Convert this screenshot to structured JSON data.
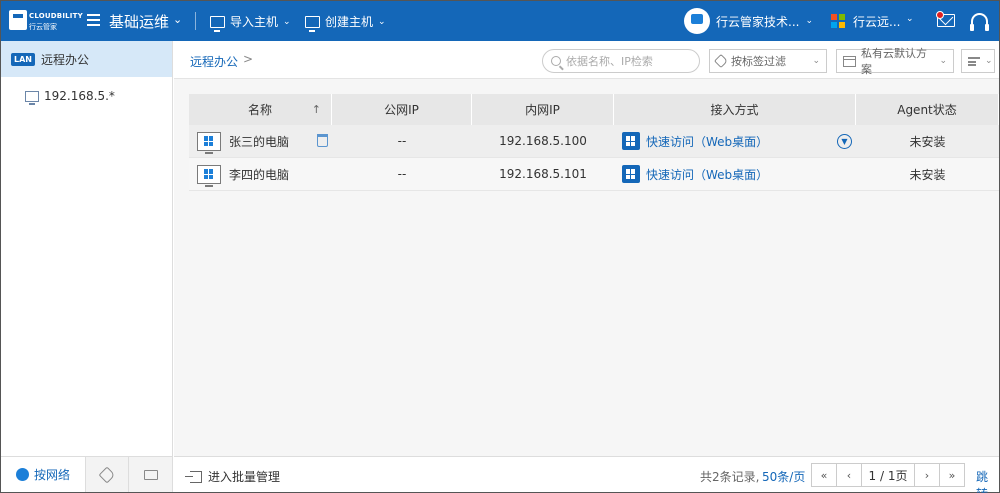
{
  "brand": {
    "name_en": "CLOUDBILITY",
    "name_cn": "行云管家"
  },
  "header": {
    "module_title": "基础运维",
    "import_host": "导入主机",
    "create_host": "创建主机",
    "tenant_name": "行云管家技术...",
    "org_name": "行云远...",
    "accent_color": "#1467b8"
  },
  "sidebar": {
    "root_badge": "LAN",
    "root_label": "远程办公",
    "items": [
      {
        "label": "192.168.5.*"
      }
    ],
    "tabs": [
      {
        "label": "按网络",
        "icon": "globe-icon"
      },
      {
        "label": "",
        "icon": "tag-icon"
      },
      {
        "label": "",
        "icon": "folder-icon"
      }
    ]
  },
  "toolbar": {
    "breadcrumb": "远程办公",
    "breadcrumb_sep": ">",
    "search_placeholder": "依据名称、IP检索",
    "tag_filter": "按标签过滤",
    "scheme_filter": "私有云默认方案"
  },
  "table": {
    "columns": [
      "名称",
      "公网IP",
      "内网IP",
      "接入方式",
      "Agent状态"
    ],
    "sort_indicator": "↑",
    "rows": [
      {
        "name": "张三的电脑",
        "public_ip": "--",
        "private_ip": "192.168.5.100",
        "access": "快速访问（Web桌面）",
        "agent": "未安装"
      },
      {
        "name": "李四的电脑",
        "public_ip": "--",
        "private_ip": "192.168.5.101",
        "access": "快速访问（Web桌面）",
        "agent": "未安装"
      }
    ]
  },
  "footer": {
    "batch_label": "进入批量管理",
    "total": "共2条记录,",
    "per_page": "50条/页",
    "page": "1 / 1页",
    "first": "«",
    "prev": "‹",
    "next": "›",
    "last": "»",
    "jump": "跳转"
  }
}
